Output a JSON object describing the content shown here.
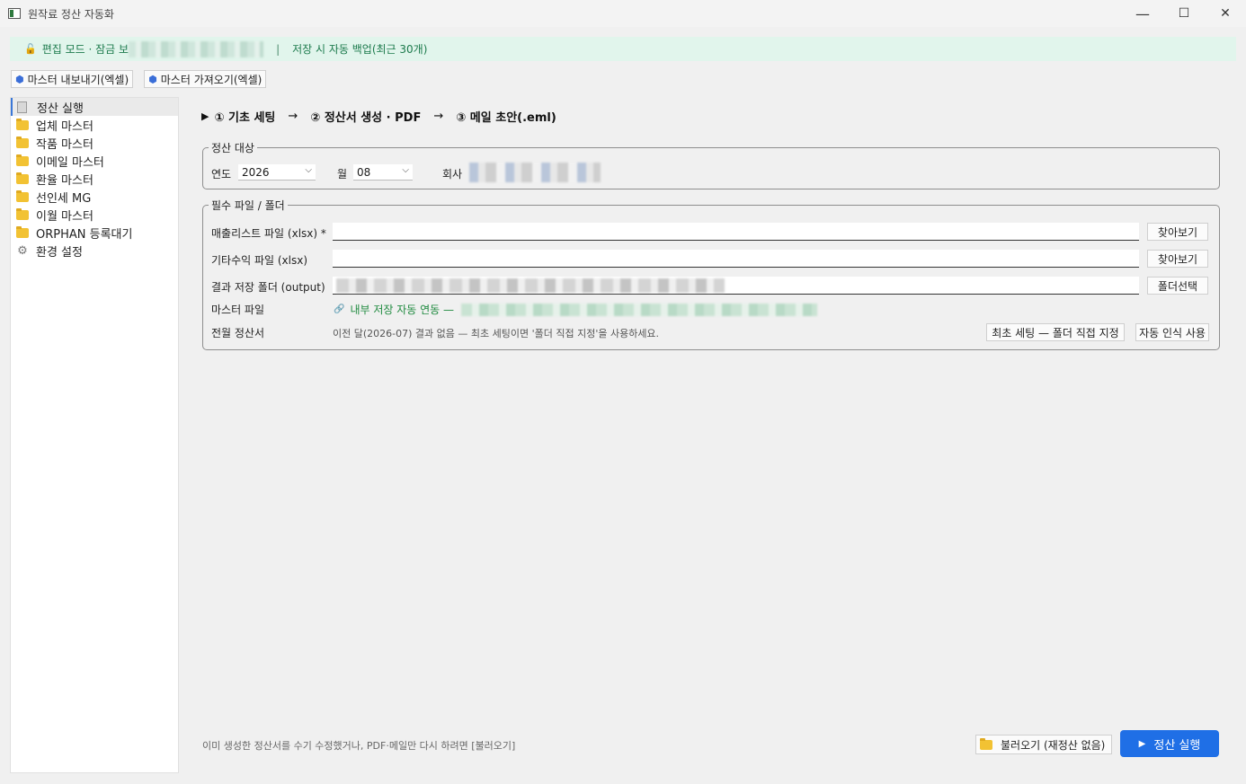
{
  "window": {
    "title": "원작료 정산 자동화",
    "minimize": "—",
    "maximize": "☐",
    "close": "✕"
  },
  "banner": {
    "lock_icon": "🔓",
    "text": "편집 모드 · 잠금 보",
    "separator": "|",
    "backup": "저장 시 자동 백업(최근 30개)"
  },
  "toolbar": {
    "export_label": "마스터 내보내기(엑셀)",
    "import_label": "마스터 가져오기(엑셀)",
    "icon_glyph": "⬢"
  },
  "sidebar": {
    "items": [
      {
        "label": "정산 실행",
        "icon": "doc-icon",
        "active": true
      },
      {
        "label": "업체 마스터",
        "icon": "folder-icon"
      },
      {
        "label": "작품 마스터",
        "icon": "folder-icon"
      },
      {
        "label": "이메일 마스터",
        "icon": "folder-icon"
      },
      {
        "label": "환율 마스터",
        "icon": "folder-icon"
      },
      {
        "label": "선인세 MG",
        "icon": "folder-icon"
      },
      {
        "label": "이월 마스터",
        "icon": "folder-icon"
      },
      {
        "label": "ORPHAN 등록대기",
        "icon": "folder-icon"
      },
      {
        "label": "환경 설정",
        "icon": "gear-icon"
      }
    ],
    "gear_glyph": "⚙"
  },
  "steps": {
    "play": "▶",
    "step1": "① 기초 세팅",
    "arrow": "→",
    "step2": "② 정산서 생성 · PDF",
    "step3": "③ 메일 초안(.eml)"
  },
  "target": {
    "group_title": "정산 대상",
    "year_label": "연도",
    "year_value": "2026",
    "month_label": "월",
    "month_value": "08",
    "company_label": "회사",
    "chevron": "⌵"
  },
  "files": {
    "group_title": "필수 파일 / 폴더",
    "sales_label": "매출리스트 파일 (xlsx) *",
    "sales_value": "",
    "other_label": "기타수익 파일 (xlsx)",
    "other_value": "",
    "output_label": "결과 저장 폴더 (output)",
    "browse1": "찾아보기",
    "browse2": "찾아보기",
    "folder_select": "폴더선택",
    "master_label": "마스터 파일",
    "link_icon": "🔗",
    "master_link": "내부 저장 자동 연동 —",
    "prev_label": "전월 정산서",
    "prev_hint": "이전 달(2026-07) 결과 없음 — 최초 세팅이면 '폴더 직접 지정'을 사용하세요.",
    "manual_button": "최초 세팅 — 폴더 직접 지정",
    "auto_button": "자동 인식 사용"
  },
  "footer": {
    "hint": "이미 생성한 정산서를 수기 수정했거나, PDF·메일만 다시 하려면 [불러오기]",
    "load_button": "불러오기 (재정산 없음)",
    "run_button": "정산 실행",
    "run_icon": "▶"
  }
}
